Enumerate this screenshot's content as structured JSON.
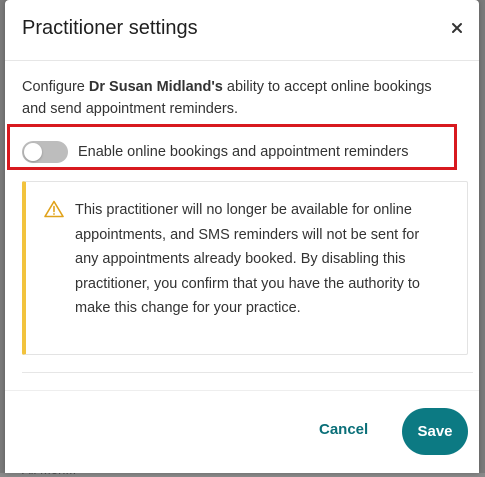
{
  "background_hint": "All Mon...",
  "modal": {
    "title": "Practitioner settings",
    "close_icon": "close-icon",
    "description_prefix": "Configure ",
    "practitioner_name": "Dr Susan Midland's",
    "description_suffix": " ability to accept online bookings and send appointment reminders.",
    "toggle": {
      "label": "Enable online bookings and appointment reminders",
      "state": "off"
    },
    "warning": {
      "icon": "warning-icon",
      "text": "This practitioner will no longer be available for online appointments, and SMS reminders will not be sent for any appointments already booked. By disabling this practitioner, you confirm that you have the authority to make this change for your practice."
    },
    "footer": {
      "cancel_label": "Cancel",
      "save_label": "Save"
    }
  },
  "colors": {
    "accent": "#0c7a83",
    "link": "#0a6f78",
    "warning_bar": "#f2c33d",
    "highlight": "#d8191f",
    "toggle_off": "#bdbdbd"
  }
}
